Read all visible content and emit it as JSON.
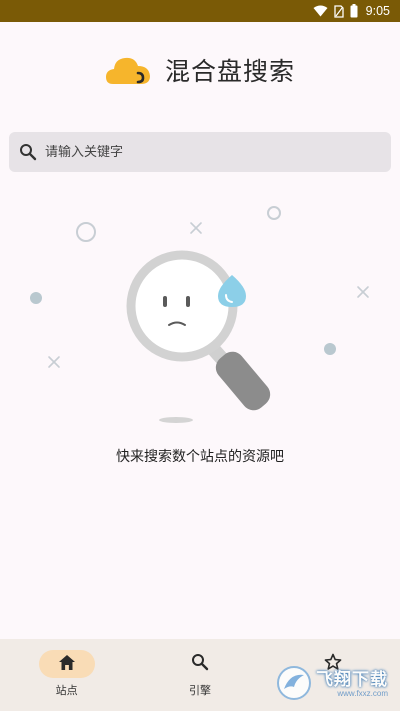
{
  "status_bar": {
    "time": "9:05",
    "icons": [
      "wifi-icon",
      "sim-icon",
      "battery-icon"
    ]
  },
  "header": {
    "title": "混合盘搜索",
    "logo_color": "#f6b52c"
  },
  "search": {
    "placeholder": "请输入关键字",
    "value": ""
  },
  "empty_state": {
    "message": "快来搜索数个站点的资源吧"
  },
  "bottom_nav": {
    "items": [
      {
        "label": "站点",
        "icon": "home-icon",
        "active": true
      },
      {
        "label": "引擎",
        "icon": "search-icon",
        "active": false
      },
      {
        "label": "",
        "icon": "star-icon",
        "active": false
      }
    ]
  },
  "watermark": {
    "text": "飞翔下载",
    "url": "www.fxxz.com"
  },
  "colors": {
    "status_bar": "#7a5a06",
    "accent": "#f9dcb6",
    "background": "#fdf8fb",
    "nav_background": "#f1ebe6"
  }
}
